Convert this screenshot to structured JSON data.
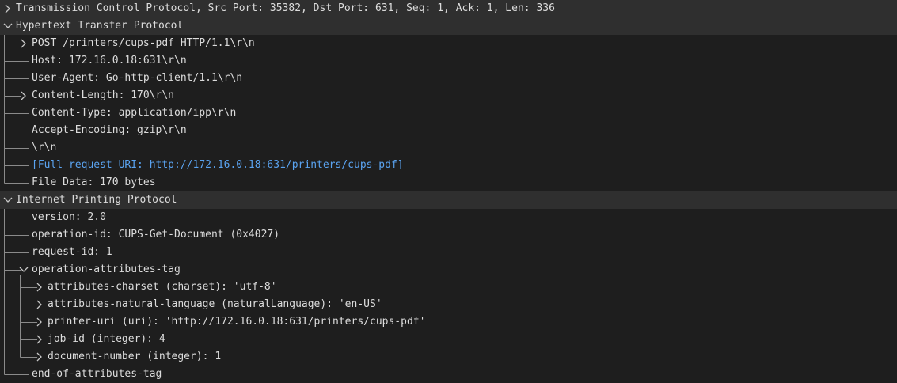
{
  "rows": [
    {
      "text": "Transmission Control Protocol, Src Port: 35382, Dst Port: 631, Seq: 1, Ack: 1, Len: 336",
      "level": 0,
      "expander": "collapsed",
      "header": true
    },
    {
      "text": "Hypertext Transfer Protocol",
      "level": 0,
      "expander": "expanded",
      "header": true
    },
    {
      "text": "POST /printers/cups-pdf HTTP/1.1\\r\\n",
      "level": 1,
      "expander": "collapsed"
    },
    {
      "text": "Host: 172.16.0.18:631\\r\\n",
      "level": 1,
      "expander": "none"
    },
    {
      "text": "User-Agent: Go-http-client/1.1\\r\\n",
      "level": 1,
      "expander": "none"
    },
    {
      "text": "Content-Length: 170\\r\\n",
      "level": 1,
      "expander": "collapsed"
    },
    {
      "text": "Content-Type: application/ipp\\r\\n",
      "level": 1,
      "expander": "none"
    },
    {
      "text": "Accept-Encoding: gzip\\r\\n",
      "level": 1,
      "expander": "none"
    },
    {
      "text": "\\r\\n",
      "level": 1,
      "expander": "none"
    },
    {
      "text": "[Full request URI: http://172.16.0.18:631/printers/cups-pdf]",
      "level": 1,
      "expander": "none",
      "link": true
    },
    {
      "text": "File Data: 170 bytes",
      "level": 1,
      "expander": "none"
    },
    {
      "text": "Internet Printing Protocol",
      "level": 0,
      "expander": "expanded",
      "header": true
    },
    {
      "text": "version: 2.0",
      "level": 1,
      "expander": "none"
    },
    {
      "text": "operation-id: CUPS-Get-Document (0x4027)",
      "level": 1,
      "expander": "none"
    },
    {
      "text": "request-id: 1",
      "level": 1,
      "expander": "none"
    },
    {
      "text": "operation-attributes-tag",
      "level": 1,
      "expander": "expanded"
    },
    {
      "text": "attributes-charset (charset): 'utf-8'",
      "level": 2,
      "expander": "collapsed"
    },
    {
      "text": "attributes-natural-language (naturalLanguage): 'en-US'",
      "level": 2,
      "expander": "collapsed"
    },
    {
      "text": "printer-uri (uri): 'http://172.16.0.18:631/printers/cups-pdf'",
      "level": 2,
      "expander": "collapsed"
    },
    {
      "text": "job-id (integer): 4",
      "level": 2,
      "expander": "collapsed"
    },
    {
      "text": "document-number (integer): 1",
      "level": 2,
      "expander": "collapsed"
    },
    {
      "text": "end-of-attributes-tag",
      "level": 1,
      "expander": "none"
    }
  ],
  "colors": {
    "background": "#1e1e1e",
    "header_background": "#2f2f2f",
    "text": "#dcdcdc",
    "link": "#5aa3f0",
    "tree_lines": "#8a8a8a"
  },
  "icons": {
    "collapsed": "chevron-right-icon",
    "expanded": "chevron-down-icon"
  }
}
